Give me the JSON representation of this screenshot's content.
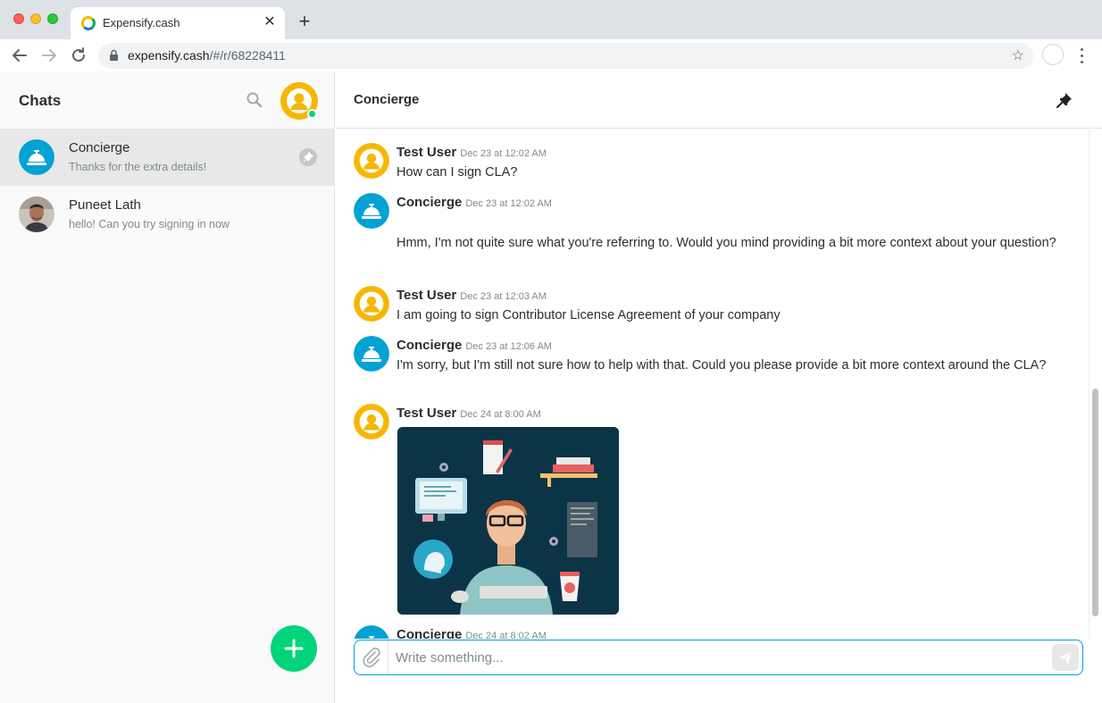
{
  "browser": {
    "tab_title": "Expensify.cash",
    "url_host": "expensify.cash",
    "url_path": "/#/r/68228411"
  },
  "sidebar": {
    "title": "Chats",
    "chats": [
      {
        "name": "Concierge",
        "preview": "Thanks for the extra details!",
        "active": true,
        "pinned": true
      },
      {
        "name": "Puneet Lath",
        "preview": "hello! Can you try signing in now",
        "active": false,
        "pinned": false
      }
    ]
  },
  "main": {
    "title": "Concierge",
    "messages": [
      {
        "author": "Test User",
        "time": "Dec 23 at 12:02 AM",
        "text": "How can I sign CLA?"
      },
      {
        "author": "Concierge",
        "time": "Dec 23 at 12:02 AM",
        "text": "Hmm, I'm not quite sure what you're referring to. Would you mind providing a bit more context about your question?"
      },
      {
        "author": "Test User",
        "time": "Dec 23 at 12:03 AM",
        "text": "I am going to sign  Contributor License Agreement of your company"
      },
      {
        "author": "Concierge",
        "time": "Dec 23 at 12:06 AM",
        "text": "I'm sorry, but I'm still not sure how to help with that. Could you please provide a bit more context around the CLA?"
      },
      {
        "author": "Test User",
        "time": "Dec 24 at 8:00 AM",
        "text": ""
      },
      {
        "author": "Concierge",
        "time": "Dec 24 at 8:02 AM",
        "text": ""
      }
    ],
    "composer_placeholder": "Write something..."
  },
  "colors": {
    "accent": "#03d47c",
    "concierge_blue": "#03a2d4",
    "user_yellow": "#f6b700"
  },
  "icons": [
    "search-icon",
    "pin-icon",
    "paperclip-icon",
    "send-icon",
    "plus-icon",
    "bell-icon",
    "lock-icon",
    "star-icon"
  ]
}
